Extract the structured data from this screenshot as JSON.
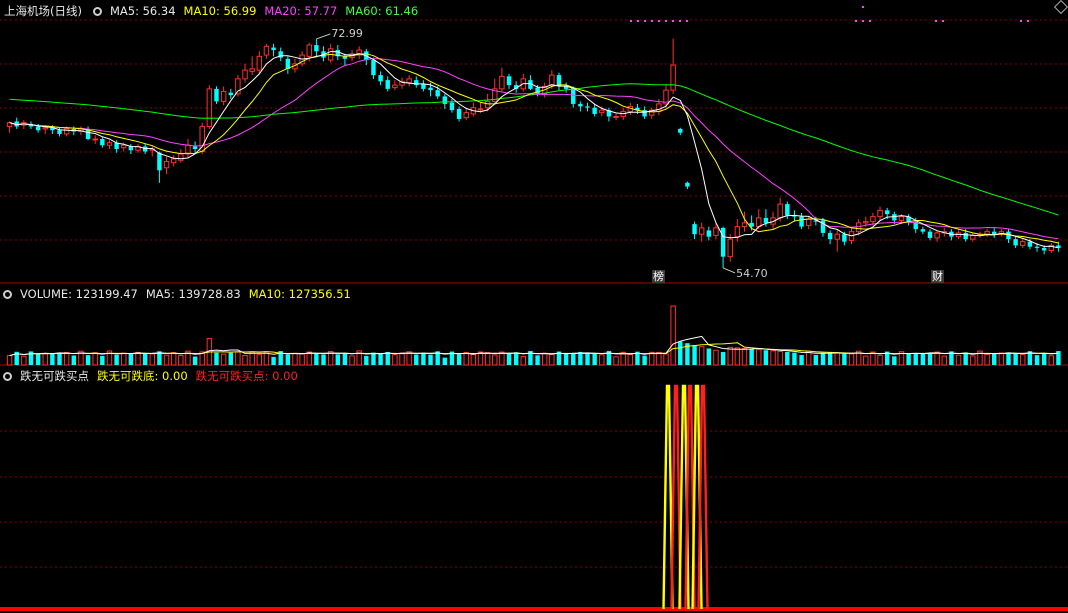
{
  "panel_main": {
    "title": "上海机场(日线)",
    "ma5": "MA5: 56.34",
    "ma10": "MA10: 56.99",
    "ma20": "MA20: 57.77",
    "ma60": "MA60: 61.46",
    "high_label": "72.99",
    "low_label": "54.70",
    "marker_bang": "榜",
    "marker_cai": "财"
  },
  "panel_volume": {
    "title": "VOLUME: 123199.47",
    "ma5": "MA5: 139728.83",
    "ma10": "MA10: 127356.51"
  },
  "panel_indicator": {
    "title": "跌无可跌买点",
    "line1": "跌无可跌底: 0.00",
    "line2": "跌无可跌买点: 0.00"
  },
  "colors": {
    "up": "#ff3030",
    "down": "#00ffff",
    "ma5": "#ffffff",
    "ma10": "#ffff00",
    "ma20": "#ff40ff",
    "ma60": "#00ff00",
    "grid": "#8b0000",
    "border": "#b00000"
  },
  "icons": [
    "gear-icon",
    "diamond-icon"
  ],
  "chart_data": [
    {
      "type": "candlestick",
      "title": "上海机场(日线)",
      "ylim": [
        53.5,
        74.5
      ],
      "high_annotation": 72.99,
      "low_annotation": 54.7,
      "candles": [
        [
          66.0,
          66.3,
          65.5,
          66.4
        ],
        [
          66.4,
          66.0,
          65.8,
          66.7
        ],
        [
          66.1,
          66.3,
          65.8,
          66.5
        ],
        [
          66.2,
          66.0,
          65.8,
          66.4
        ],
        [
          66.0,
          65.7,
          65.5,
          66.2
        ],
        [
          65.8,
          65.9,
          65.4,
          66.1
        ],
        [
          65.9,
          65.7,
          65.4,
          66.1
        ],
        [
          65.7,
          65.4,
          65.2,
          65.9
        ],
        [
          65.4,
          65.8,
          65.2,
          66.0
        ],
        [
          65.8,
          65.6,
          65.3,
          66.0
        ],
        [
          65.6,
          65.8,
          65.3,
          66.0
        ],
        [
          65.8,
          65.0,
          64.9,
          66.0
        ],
        [
          65.0,
          65.0,
          64.6,
          65.3
        ],
        [
          65.0,
          64.5,
          64.3,
          65.2
        ],
        [
          64.5,
          64.7,
          64.2,
          64.9
        ],
        [
          64.7,
          64.2,
          63.9,
          64.9
        ],
        [
          64.3,
          64.5,
          64.0,
          64.7
        ],
        [
          64.4,
          64.1,
          63.8,
          64.6
        ],
        [
          64.1,
          64.4,
          63.9,
          64.6
        ],
        [
          64.4,
          64.0,
          63.8,
          64.6
        ],
        [
          64.1,
          64.2,
          63.6,
          64.4
        ],
        [
          63.9,
          62.5,
          61.5,
          64.0
        ],
        [
          62.7,
          63.2,
          62.2,
          63.6
        ],
        [
          63.1,
          63.4,
          62.8,
          63.7
        ],
        [
          63.3,
          63.8,
          63.1,
          64.2
        ],
        [
          63.8,
          64.5,
          63.5,
          65.0
        ],
        [
          64.4,
          64.2,
          63.8,
          64.8
        ],
        [
          64.0,
          66.0,
          63.8,
          66.3
        ],
        [
          66.0,
          69.0,
          65.8,
          69.3
        ],
        [
          69.0,
          68.0,
          67.8,
          69.2
        ],
        [
          68.0,
          68.8,
          67.7,
          69.2
        ],
        [
          68.7,
          68.5,
          68.2,
          69.0
        ],
        [
          68.6,
          69.8,
          68.4,
          70.1
        ],
        [
          69.8,
          70.5,
          69.5,
          71.0
        ],
        [
          70.4,
          70.6,
          70.1,
          71.6
        ],
        [
          70.5,
          71.6,
          70.2,
          72.0
        ],
        [
          71.7,
          72.4,
          71.4,
          72.6
        ],
        [
          72.3,
          72.1,
          71.6,
          72.6
        ],
        [
          72.0,
          71.5,
          71.2,
          72.3
        ],
        [
          71.4,
          70.6,
          70.2,
          71.6
        ],
        [
          70.6,
          71.0,
          70.3,
          71.4
        ],
        [
          71.0,
          71.7,
          70.8,
          72.0
        ],
        [
          71.6,
          72.5,
          71.2,
          72.7
        ],
        [
          72.5,
          72.0,
          71.6,
          73.0
        ],
        [
          72.0,
          71.5,
          71.2,
          72.4
        ],
        [
          71.3,
          72.2,
          71.1,
          72.6
        ],
        [
          72.1,
          71.6,
          71.3,
          72.5
        ],
        [
          71.6,
          71.4,
          70.9,
          71.8
        ],
        [
          71.5,
          71.8,
          71.2,
          72.1
        ],
        [
          71.7,
          72.1,
          71.4,
          72.4
        ],
        [
          72.0,
          71.3,
          70.9,
          72.2
        ],
        [
          71.3,
          70.1,
          69.8,
          71.5
        ],
        [
          70.1,
          69.6,
          69.3,
          70.4
        ],
        [
          69.7,
          69.0,
          68.8,
          70.0
        ],
        [
          69.1,
          69.3,
          68.9,
          69.7
        ],
        [
          69.3,
          69.6,
          69.0,
          69.9
        ],
        [
          69.5,
          69.8,
          69.2,
          70.1
        ],
        [
          69.7,
          69.3,
          69.1,
          70.0
        ],
        [
          69.4,
          69.0,
          68.8,
          69.7
        ],
        [
          69.1,
          68.9,
          68.4,
          69.5
        ],
        [
          68.9,
          68.4,
          68.2,
          69.2
        ],
        [
          68.4,
          67.8,
          67.4,
          68.6
        ],
        [
          67.9,
          67.3,
          67.1,
          68.2
        ],
        [
          67.4,
          66.6,
          66.4,
          67.6
        ],
        [
          66.7,
          67.1,
          66.5,
          67.5
        ],
        [
          67.0,
          67.5,
          66.8,
          67.9
        ],
        [
          67.4,
          67.4,
          67.1,
          67.9
        ],
        [
          67.5,
          68.0,
          67.2,
          68.6
        ],
        [
          68.0,
          69.0,
          67.8,
          69.8
        ],
        [
          69.0,
          70.0,
          68.8,
          70.7
        ],
        [
          70.0,
          69.3,
          69.0,
          70.2
        ],
        [
          69.3,
          69.0,
          68.7,
          69.6
        ],
        [
          69.0,
          69.8,
          68.8,
          70.2
        ],
        [
          69.7,
          69.0,
          68.9,
          70.1
        ],
        [
          69.1,
          68.6,
          68.4,
          69.3
        ],
        [
          68.6,
          69.2,
          68.3,
          69.5
        ],
        [
          69.3,
          70.1,
          69.0,
          70.5
        ],
        [
          70.1,
          69.2,
          68.9,
          70.3
        ],
        [
          69.2,
          69.0,
          68.7,
          69.5
        ],
        [
          69.1,
          67.8,
          67.5,
          69.2
        ],
        [
          67.8,
          67.6,
          67.2,
          68.0
        ],
        [
          67.6,
          67.5,
          67.2,
          67.9
        ],
        [
          67.5,
          67.0,
          66.8,
          67.8
        ],
        [
          67.1,
          67.3,
          66.8,
          67.6
        ],
        [
          67.3,
          66.8,
          66.4,
          67.5
        ],
        [
          66.8,
          66.8,
          66.5,
          67.1
        ],
        [
          66.8,
          67.2,
          66.5,
          67.5
        ],
        [
          67.2,
          67.6,
          66.9,
          67.9
        ],
        [
          67.5,
          67.3,
          67.0,
          67.8
        ],
        [
          67.3,
          66.8,
          66.6,
          67.6
        ],
        [
          66.9,
          67.3,
          66.6,
          67.5
        ],
        [
          67.2,
          67.8,
          66.9,
          68.2
        ],
        [
          67.8,
          68.9,
          67.5,
          69.4
        ],
        [
          68.9,
          70.9,
          68.6,
          73.0
        ],
        [
          65.8,
          65.5,
          65.3,
          65.9
        ],
        [
          61.5,
          61.2,
          61.0,
          61.6
        ],
        [
          58.2,
          57.4,
          57.0,
          58.4
        ],
        [
          57.4,
          57.9,
          56.8,
          58.3
        ],
        [
          57.7,
          57.2,
          56.9,
          58.0
        ],
        [
          57.3,
          57.9,
          57.0,
          58.3
        ],
        [
          57.9,
          55.6,
          54.7,
          58.0
        ],
        [
          55.6,
          57.0,
          55.2,
          57.4
        ],
        [
          57.2,
          58.0,
          56.8,
          58.6
        ],
        [
          58.0,
          58.3,
          57.6,
          59.2
        ],
        [
          58.3,
          58.0,
          57.7,
          58.9
        ],
        [
          58.0,
          58.7,
          57.8,
          59.4
        ],
        [
          58.7,
          58.3,
          58.0,
          59.4
        ],
        [
          58.2,
          58.7,
          57.8,
          59.2
        ],
        [
          58.7,
          59.8,
          58.4,
          60.3
        ],
        [
          59.8,
          58.9,
          58.6,
          60.0
        ],
        [
          58.9,
          58.8,
          58.4,
          59.3
        ],
        [
          58.8,
          58.0,
          57.8,
          59.1
        ],
        [
          58.1,
          58.6,
          57.8,
          58.8
        ],
        [
          58.5,
          58.4,
          58.1,
          58.8
        ],
        [
          58.5,
          57.5,
          57.2,
          58.7
        ],
        [
          57.5,
          57.0,
          56.6,
          57.7
        ],
        [
          57.0,
          57.4,
          56.0,
          57.7
        ],
        [
          57.4,
          56.8,
          56.5,
          57.6
        ],
        [
          56.9,
          57.6,
          56.6,
          57.9
        ],
        [
          57.6,
          58.3,
          57.3,
          58.6
        ],
        [
          58.3,
          58.4,
          58.0,
          58.8
        ],
        [
          58.4,
          58.8,
          58.1,
          59.1
        ],
        [
          58.8,
          59.3,
          58.5,
          59.6
        ],
        [
          59.3,
          59.0,
          58.6,
          59.5
        ],
        [
          59.0,
          58.5,
          58.2,
          59.2
        ],
        [
          58.5,
          58.8,
          58.2,
          59.0
        ],
        [
          58.8,
          58.4,
          58.1,
          59.0
        ],
        [
          58.4,
          57.8,
          57.5,
          58.7
        ],
        [
          57.8,
          57.6,
          57.4,
          58.0
        ],
        [
          57.6,
          57.1,
          56.9,
          57.8
        ],
        [
          57.1,
          57.5,
          56.8,
          57.7
        ],
        [
          57.5,
          57.6,
          57.2,
          57.9
        ],
        [
          57.6,
          57.2,
          56.9,
          57.8
        ],
        [
          57.2,
          57.5,
          57.0,
          57.7
        ],
        [
          57.5,
          57.0,
          56.8,
          57.8
        ],
        [
          57.0,
          57.3,
          56.8,
          57.5
        ],
        [
          57.3,
          57.4,
          57.1,
          57.6
        ],
        [
          57.4,
          57.6,
          57.2,
          57.8
        ],
        [
          57.6,
          57.4,
          57.1,
          57.9
        ],
        [
          57.4,
          57.6,
          57.2,
          57.8
        ],
        [
          57.6,
          57.0,
          56.7,
          57.8
        ],
        [
          57.0,
          56.5,
          56.3,
          57.2
        ],
        [
          56.5,
          56.8,
          56.3,
          57.0
        ],
        [
          56.8,
          56.4,
          56.2,
          57.0
        ],
        [
          56.4,
          56.3,
          56.0,
          56.7
        ],
        [
          56.3,
          56.1,
          55.8,
          56.5
        ],
        [
          56.1,
          56.5,
          55.9,
          56.7
        ],
        [
          56.5,
          56.3,
          56.0,
          56.8
        ]
      ],
      "series": [
        {
          "name": "MA5",
          "value": 56.34
        },
        {
          "name": "MA10",
          "value": 56.99
        },
        {
          "name": "MA20",
          "value": 57.77
        },
        {
          "name": "MA60",
          "value": 61.46
        }
      ]
    },
    {
      "type": "bar",
      "title": "VOLUME",
      "series": [
        {
          "name": "VOLUME",
          "value": 123199.47
        },
        {
          "name": "MA5",
          "value": 139728.83
        },
        {
          "name": "MA10",
          "value": 127356.51
        }
      ]
    },
    {
      "type": "line",
      "title": "跌无可跌买点",
      "series": [
        {
          "name": "跌无可跌底",
          "value": 0.0
        },
        {
          "name": "跌无可跌买点",
          "value": 0.0
        }
      ]
    }
  ]
}
